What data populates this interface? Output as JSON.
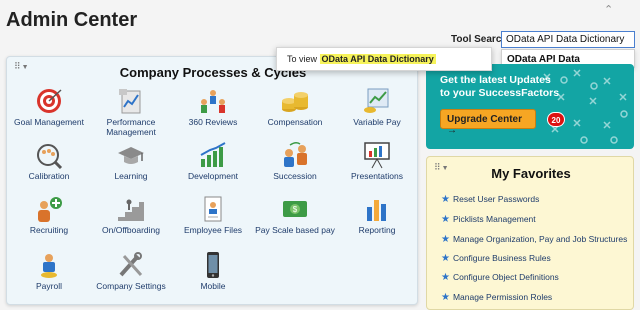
{
  "page": {
    "title": "Admin Center"
  },
  "tool_search": {
    "label": "Tool Search",
    "value": "OData API Data Dictionary",
    "suggestion": "OData API Data Dictionary"
  },
  "tooltip": {
    "prefix": "To view",
    "highlight": "OData API Data Dictionary"
  },
  "company_processes": {
    "title": "Company Processes & Cycles",
    "tiles": [
      {
        "label": "Goal Management",
        "icon": "target-icon"
      },
      {
        "label": "Performance Management",
        "icon": "chart-doc-icon"
      },
      {
        "label": "360 Reviews",
        "icon": "people-360-icon"
      },
      {
        "label": "Compensation",
        "icon": "coins-icon"
      },
      {
        "label": "Variable Pay",
        "icon": "variable-pay-icon"
      },
      {
        "label": "Calibration",
        "icon": "calibration-icon"
      },
      {
        "label": "Learning",
        "icon": "graduation-cap-icon"
      },
      {
        "label": "Development",
        "icon": "growth-chart-icon"
      },
      {
        "label": "Succession",
        "icon": "succession-icon"
      },
      {
        "label": "Presentations",
        "icon": "presentation-board-icon"
      },
      {
        "label": "Recruiting",
        "icon": "add-person-icon"
      },
      {
        "label": "On/Offboarding",
        "icon": "stairs-person-icon"
      },
      {
        "label": "Employee Files",
        "icon": "employee-file-icon"
      },
      {
        "label": "Pay Scale based pay",
        "icon": "pay-scale-icon"
      },
      {
        "label": "Reporting",
        "icon": "bar-report-icon"
      },
      {
        "label": "Payroll",
        "icon": "payroll-icon"
      },
      {
        "label": "Company Settings",
        "icon": "tools-icon"
      },
      {
        "label": "Mobile",
        "icon": "mobile-phone-icon"
      }
    ]
  },
  "upgrade": {
    "line1": "Get the latest Updates",
    "line2": "to your SuccessFactors",
    "button": "Upgrade Center →",
    "badge": "20"
  },
  "favorites": {
    "title": "My Favorites",
    "items": [
      "Reset User Passwords",
      "Picklists Management",
      "Manage Organization, Pay and Job Structures",
      "Configure Business Rules",
      "Configure Object Definitions",
      "Manage Permission Roles"
    ]
  },
  "colors": {
    "accent_teal": "#13a5a4",
    "orange": "#f6a623",
    "badge_red": "#d11111",
    "favorites_bg": "#fdf7d3",
    "panel_bg": "#eef6fa"
  }
}
